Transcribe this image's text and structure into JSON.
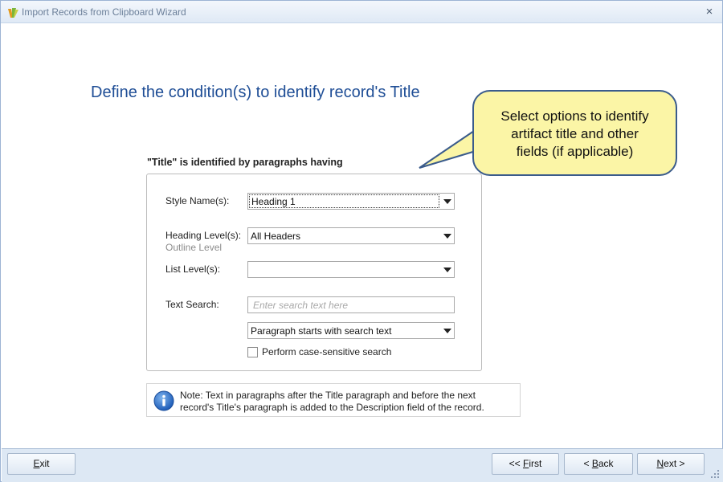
{
  "window": {
    "title": "Import Records from Clipboard Wizard",
    "close_glyph": "×"
  },
  "page": {
    "heading": "Define the condition(s) to identify record's Title"
  },
  "callout": {
    "line1": "Select options to identify",
    "line2": "artifact title and other",
    "line3": "fields (if applicable)"
  },
  "group": {
    "label": "\"Title\" is identified by paragraphs having"
  },
  "form": {
    "style_name": {
      "label": "Style Name(s):",
      "value": "Heading 1"
    },
    "heading_level": {
      "label": "Heading Level(s):",
      "sublabel": "Outline Level",
      "value": "All Headers"
    },
    "list_level": {
      "label": "List Level(s):",
      "value": ""
    },
    "text_search": {
      "label": "Text Search:",
      "value": "",
      "placeholder": "Enter search text here",
      "mode_value": "Paragraph starts with search text"
    },
    "case_sensitive": {
      "label": "Perform case-sensitive search",
      "checked": false
    }
  },
  "note": {
    "line1": "Note: Text in paragraphs after the Title paragraph and before the next",
    "line2": "record's Title's paragraph is added to the Description field of the record."
  },
  "footer": {
    "exit_mnemonic": "E",
    "exit_rest": "xit",
    "first_prefix": "<< ",
    "first_mnemonic": "F",
    "first_rest": "irst",
    "back_prefix": "< ",
    "back_mnemonic": "B",
    "back_rest": "ack",
    "next_mnemonic": "N",
    "next_rest": "ext >"
  },
  "icons": {
    "app": "app-logo-icon",
    "close": "close-icon",
    "dropdown": "chevron-down-icon",
    "info": "info-icon",
    "resize": "resize-grip-icon"
  },
  "colors": {
    "heading": "#1f4e96",
    "callout_fill": "#fbf5a6",
    "callout_border": "#3a5b8c",
    "footer_bg": "#dde8f4"
  }
}
